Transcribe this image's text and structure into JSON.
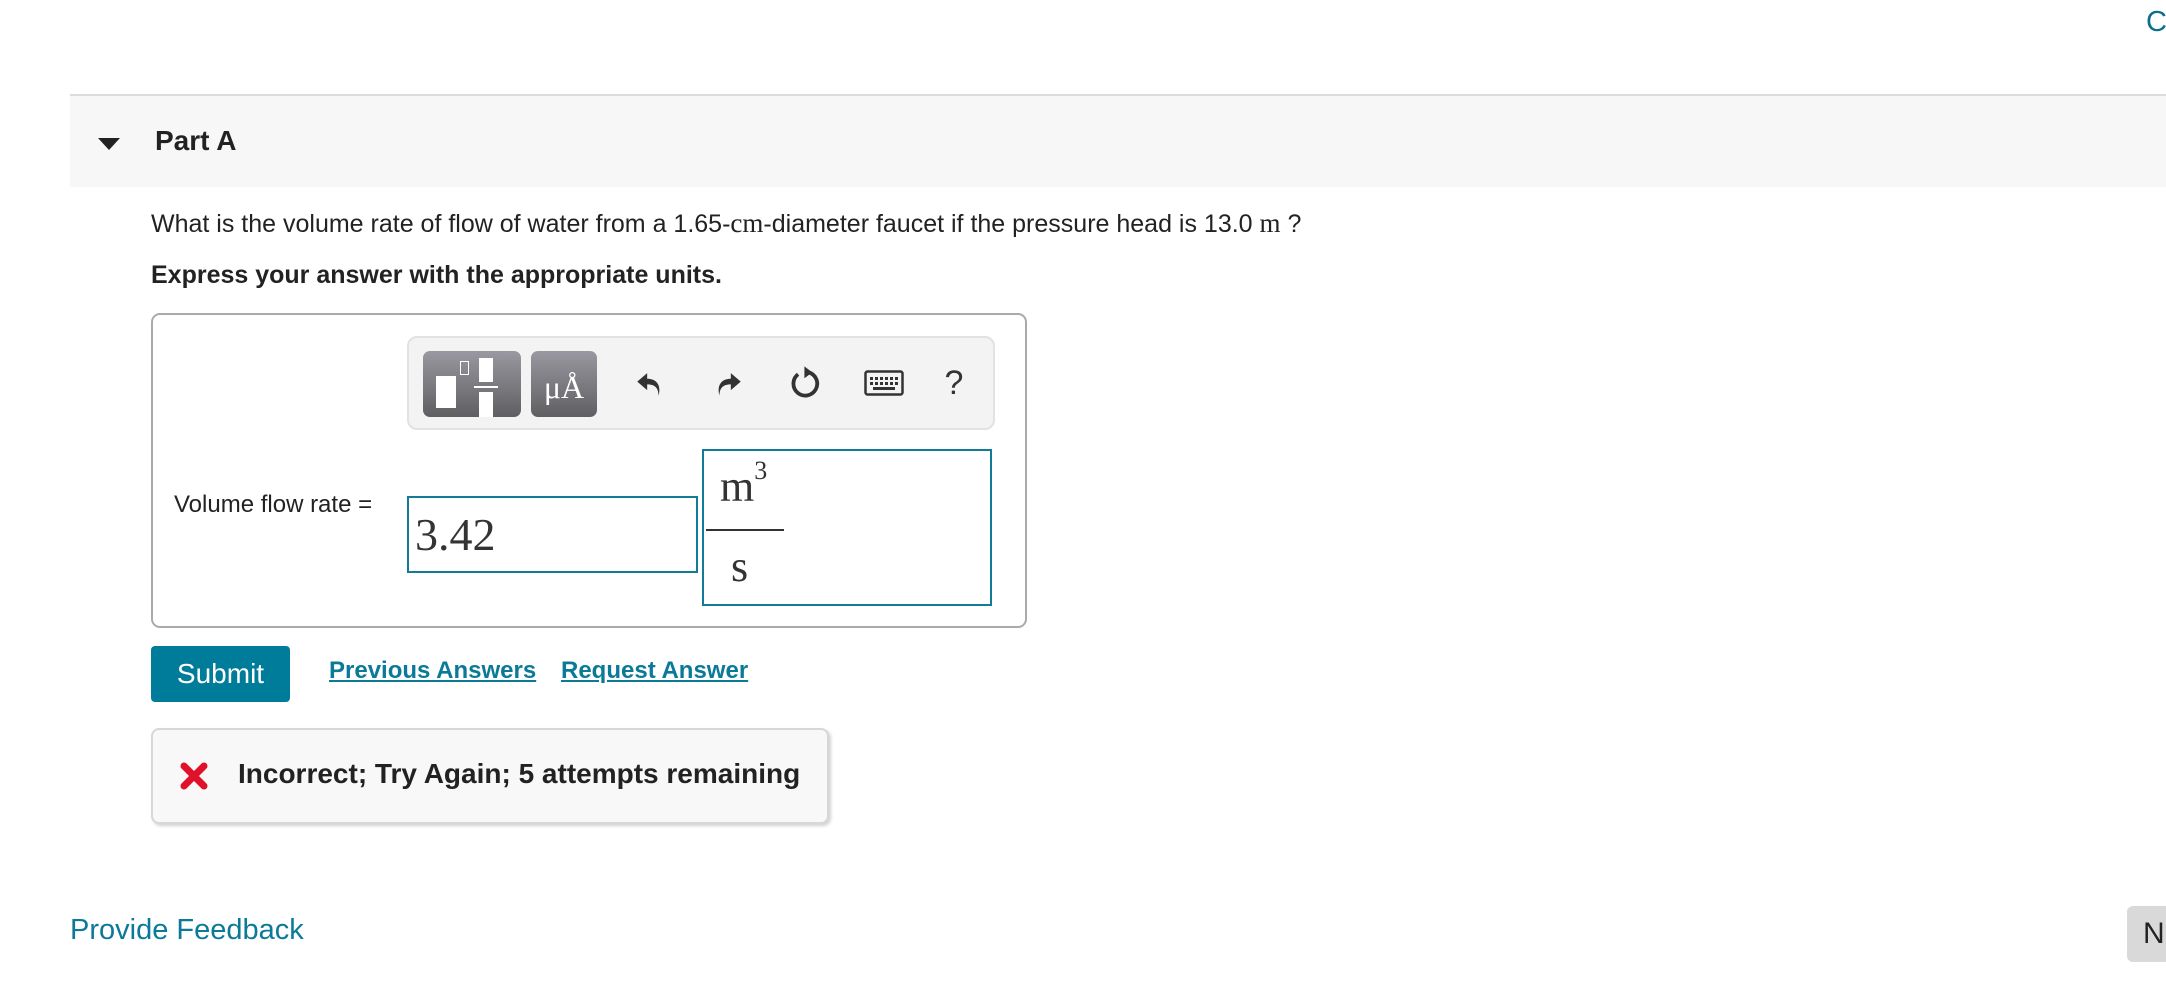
{
  "top_link": {
    "label": "C"
  },
  "part": {
    "title": "Part A",
    "expanded": true
  },
  "question": {
    "text_before": "What is the volume rate of flow of water from a 1.65-",
    "unit_cm": "cm",
    "text_middle": "-diameter faucet if the pressure head is 13.0 ",
    "unit_m": "m",
    "text_after": " ?"
  },
  "instructions": "Express your answer with the appropriate units.",
  "toolbar": {
    "units_label": "μÅ",
    "help_label": "?",
    "icons": [
      "templates-icon",
      "units-icon",
      "undo-icon",
      "redo-icon",
      "reset-icon",
      "keyboard-icon",
      "help-icon"
    ]
  },
  "answer": {
    "label": "Volume flow rate =",
    "value": "3.42",
    "unit_numerator": "m",
    "unit_numerator_exp": "3",
    "unit_denominator": "s"
  },
  "actions": {
    "submit": "Submit",
    "previous_answers": "Previous Answers",
    "request_answer": "Request Answer"
  },
  "feedback": {
    "status": "incorrect",
    "message": "Incorrect; Try Again; 5 attempts remaining"
  },
  "footer": {
    "provide_feedback": "Provide Feedback",
    "next_label": "N"
  },
  "colors": {
    "accent": "#007c9b",
    "link": "#0b7a99",
    "error": "#e0112b",
    "input_border": "#127c98"
  }
}
